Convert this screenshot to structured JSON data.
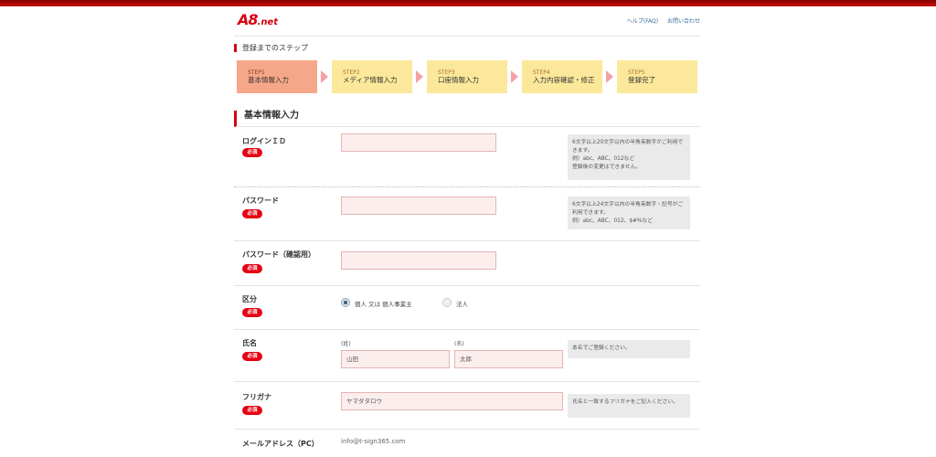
{
  "header": {
    "logo": "A8",
    "logo_suffix": ".net",
    "links": [
      "ヘルプ(FAQ)",
      "お問い合わせ"
    ]
  },
  "steps_title": "登録までのステップ",
  "steps": [
    {
      "num": "STEP1",
      "label": "基本情報入力"
    },
    {
      "num": "STEP2",
      "label": "メディア情報入力"
    },
    {
      "num": "STEP3",
      "label": "口座情報入力"
    },
    {
      "num": "STEP4",
      "label": "入力内容確認・修正"
    },
    {
      "num": "STEP5",
      "label": "登録完了"
    }
  ],
  "section_title": "基本情報入力",
  "required_badge": "必須",
  "fields": {
    "login": {
      "label": "ログインＩＤ",
      "help": [
        "6文字以上20文字以内の半角英数字がご利用できます。",
        "例）abc、ABC、012など",
        "登録後の変更はできません。"
      ]
    },
    "password": {
      "label": "パスワード",
      "help": [
        "6文字以上24文字以内の半角英数字・記号がご利用できます。",
        "例）abc、ABC、012、$#%など"
      ]
    },
    "password_confirm": {
      "label": "パスワード（確認用）"
    },
    "category": {
      "label": "区分",
      "options": [
        "個人 又は 個人事業主",
        "法人"
      ]
    },
    "name": {
      "label": "氏名",
      "sei_label": "(姓)",
      "mei_label": "(名)",
      "sei_placeholder": "山田",
      "mei_placeholder": "太郎",
      "help": "本名でご登録ください。"
    },
    "furigana": {
      "label": "フリガナ",
      "placeholder": "ヤマダタロウ",
      "help": "氏名と一致するフリガナをご記入ください。"
    },
    "email": {
      "label": "メールアドレス（PC）",
      "value": "info@t-sign365.com"
    }
  }
}
